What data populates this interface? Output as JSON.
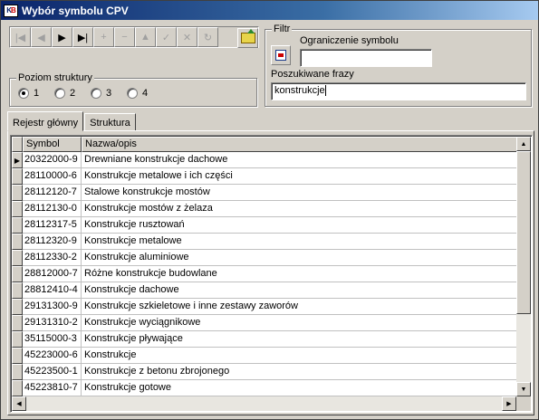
{
  "window": {
    "title": "Wybór symbolu CPV",
    "icon": "app-icon"
  },
  "toolbar": {
    "buttons": [
      {
        "name": "first-record-icon",
        "glyph": "|◀",
        "enabled": false
      },
      {
        "name": "prior-record-icon",
        "glyph": "◀",
        "enabled": false
      },
      {
        "name": "next-record-icon",
        "glyph": "▶",
        "enabled": true
      },
      {
        "name": "last-record-icon",
        "glyph": "▶|",
        "enabled": true
      },
      {
        "name": "insert-icon",
        "glyph": "+",
        "enabled": false
      },
      {
        "name": "delete-icon",
        "glyph": "−",
        "enabled": false
      },
      {
        "name": "edit-icon",
        "glyph": "▲",
        "enabled": false
      },
      {
        "name": "post-icon",
        "glyph": "✓",
        "enabled": false
      },
      {
        "name": "cancel-icon",
        "glyph": "✕",
        "enabled": false
      },
      {
        "name": "refresh-icon",
        "glyph": "↻",
        "enabled": false
      }
    ],
    "open_icon": "folder-open-icon"
  },
  "poziom": {
    "legend": "Poziom struktury",
    "options": [
      "1",
      "2",
      "3",
      "4"
    ],
    "selected": "1"
  },
  "filtr": {
    "legend": "Filtr",
    "ograniczenie_label": "Ograniczenie symbolu",
    "ograniczenie_value": "",
    "poszukiwane_label": "Poszukiwane frazy",
    "poszukiwane_value": "konstrukcje"
  },
  "tabs": [
    {
      "label": "Rejestr główny",
      "active": true
    },
    {
      "label": "Struktura",
      "active": false
    }
  ],
  "grid": {
    "columns": [
      "Symbol",
      "Nazwa/opis"
    ],
    "rows": [
      {
        "symbol": "20322000-9",
        "nazwa": "Drewniane konstrukcje dachowe"
      },
      {
        "symbol": "28110000-6",
        "nazwa": "Konstrukcje metalowe i ich części"
      },
      {
        "symbol": "28112120-7",
        "nazwa": "Stalowe konstrukcje mostów"
      },
      {
        "symbol": "28112130-0",
        "nazwa": "Konstrukcje mostów z żelaza"
      },
      {
        "symbol": "28112317-5",
        "nazwa": "Konstrukcje rusztowań"
      },
      {
        "symbol": "28112320-9",
        "nazwa": "Konstrukcje metalowe"
      },
      {
        "symbol": "28112330-2",
        "nazwa": "Konstrukcje aluminiowe"
      },
      {
        "symbol": "28812000-7",
        "nazwa": "Różne konstrukcje budowlane"
      },
      {
        "symbol": "28812410-4",
        "nazwa": "Konstrukcje dachowe"
      },
      {
        "symbol": "29131300-9",
        "nazwa": "Konstrukcje szkieletowe i inne zestawy zaworów"
      },
      {
        "symbol": "29131310-2",
        "nazwa": "Konstrukcje wyciągnikowe"
      },
      {
        "symbol": "35115000-3",
        "nazwa": "Konstrukcje pływające"
      },
      {
        "symbol": "45223000-6",
        "nazwa": "Konstrukcje"
      },
      {
        "symbol": "45223500-1",
        "nazwa": "Konstrukcje z betonu zbrojonego"
      },
      {
        "symbol": "45223810-7",
        "nazwa": "Konstrukcje gotowe"
      }
    ],
    "current_row": 0
  }
}
